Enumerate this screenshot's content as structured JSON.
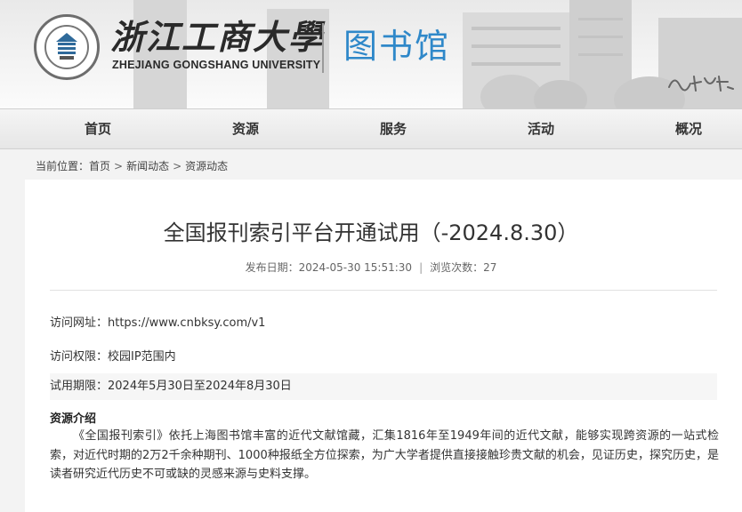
{
  "header": {
    "university_cn": "浙江工商大學",
    "university_en": "ZHEJIANG GONGSHANG UNIVERSITY",
    "library_name": "图书馆"
  },
  "nav": {
    "items": [
      {
        "label": "首页"
      },
      {
        "label": "资源"
      },
      {
        "label": "服务"
      },
      {
        "label": "活动"
      },
      {
        "label": "概况"
      }
    ]
  },
  "breadcrumb": {
    "prefix": "当前位置：",
    "items": [
      "首页",
      "新闻动态",
      "资源动态"
    ],
    "separator": ">"
  },
  "article": {
    "title": "全国报刊索引平台开通试用（-2024.8.30）",
    "meta_date_label": "发布日期：",
    "meta_date": "2024-05-30 15:51:30",
    "meta_sep": "|",
    "meta_views_label": "浏览次数：",
    "meta_views": "27",
    "url_line": "访问网址：https://www.cnbksy.com/v1",
    "access_line": "访问权限：校园IP范围内",
    "trial_line": "试用期限：2024年5月30日至2024年8月30日",
    "section_title": "资源介绍",
    "body": "《全国报刊索引》依托上海图书馆丰富的近代文献馆藏，汇集1816年至1949年间的近代文献，能够实现跨资源的一站式检索，对近代时期的2万2千余种期刊、1000种报纸全方位探索，为广大学者提供直接接触珍贵文献的机会，见证历史，探究历史，是读者研究近代历史不可或缺的灵感来源与史料支撑。"
  },
  "colors": {
    "library_blue": "#2f88c9",
    "background": "#f3f3f3"
  }
}
